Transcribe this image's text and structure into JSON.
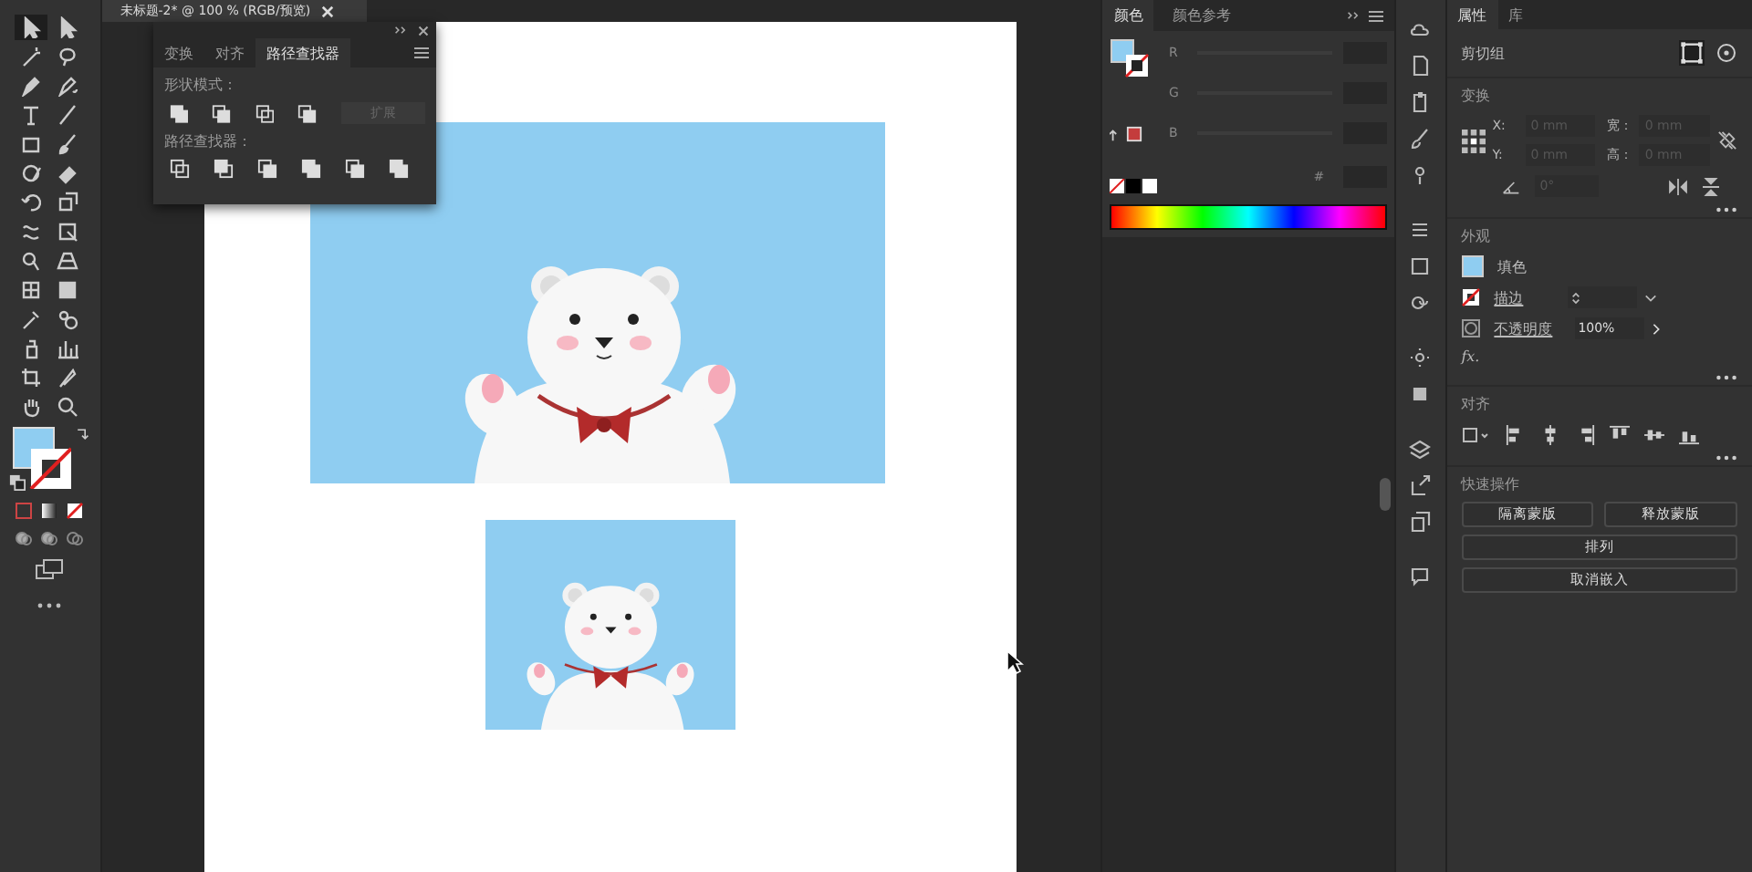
{
  "document_tab": {
    "title": "未标题-2* @ 100 % (RGB/预览)"
  },
  "pathfinder_panel": {
    "tabs": [
      {
        "label": "变换",
        "selected": false
      },
      {
        "label": "对齐",
        "selected": false
      },
      {
        "label": "路径查找器",
        "selected": true
      }
    ],
    "shape_modes_label": "形状模式：",
    "expand_button": {
      "label": "扩展",
      "disabled": true
    },
    "pathfinders_label": "路径查找器："
  },
  "color_panel": {
    "tabs": [
      {
        "label": "颜色",
        "selected": true
      },
      {
        "label": "颜色参考",
        "selected": false
      }
    ],
    "channels": [
      {
        "label": "R"
      },
      {
        "label": "G"
      },
      {
        "label": "B"
      }
    ],
    "hex_label": "#"
  },
  "properties_panel": {
    "tabs": [
      {
        "label": "属性",
        "selected": true
      },
      {
        "label": "库",
        "selected": false
      }
    ],
    "object_type": "剪切组",
    "transform": {
      "title": "变换",
      "disabled": true,
      "fields": [
        {
          "label": "X:",
          "value": "0 mm"
        },
        {
          "label": "宽：",
          "value": "0 mm"
        },
        {
          "label": "Y:",
          "value": "0 mm"
        },
        {
          "label": "高：",
          "value": "0 mm"
        }
      ],
      "angle_value": "0°"
    },
    "appearance": {
      "title": "外观",
      "fill_label": "填色",
      "stroke_label": "描边",
      "opacity_label": "不透明度",
      "opacity_value": "100%",
      "fx_label": "fx."
    },
    "align": {
      "title": "对齐"
    },
    "quick_actions": {
      "title": "快速操作",
      "rows": [
        [
          "隔离蒙版",
          "释放蒙版"
        ],
        [
          "排列"
        ],
        [
          "取消嵌入"
        ]
      ]
    }
  }
}
